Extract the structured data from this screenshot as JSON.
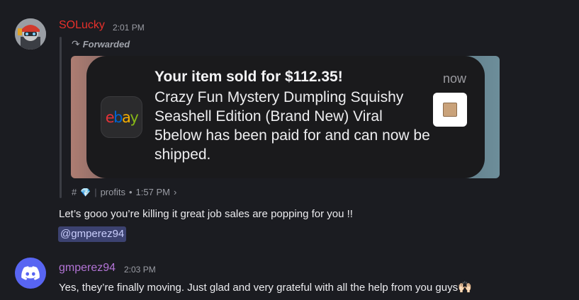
{
  "messages": [
    {
      "username": "SOLucky",
      "timestamp": "2:01 PM",
      "forwarded_label": "Forwarded",
      "notification": {
        "title": "Your item sold for $112.35!",
        "body": "Crazy Fun Mystery Dumpling Squishy Seashell Edition (Brand New) Viral 5below has been paid for and can now be shipped.",
        "time": "now",
        "app_logo_letters": [
          "e",
          "b",
          "a",
          "y"
        ],
        "logo_colors": [
          "#e53238",
          "#0064d2",
          "#f5af02",
          "#86b817"
        ]
      },
      "source": {
        "hash": "#",
        "gem": "💎",
        "separator": "|",
        "channel": "profits",
        "dot": "•",
        "time": "1:57 PM",
        "chevron": "›"
      },
      "text": "Let’s gooo you’re killing it great job sales are popping for you !!",
      "mention": "@gmperez94"
    },
    {
      "username": "gmperez94",
      "timestamp": "2:03 PM",
      "text": "Yes, they’re finally moving. Just glad and very grateful with all the help from you guys",
      "emoji": "🙌🏻"
    }
  ],
  "colors": {
    "username_1": "#e8302b",
    "username_2": "#b374d6",
    "mention_bg": "#3c4270",
    "discord_blurple": "#5865f2"
  }
}
